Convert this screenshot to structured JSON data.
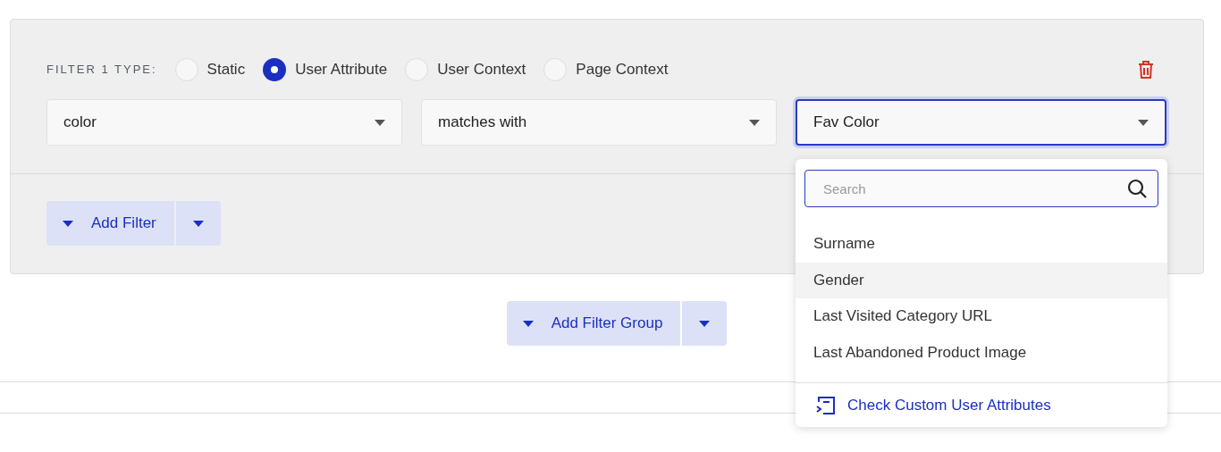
{
  "filter_type": {
    "label": "FILTER 1 TYPE:",
    "options": [
      {
        "label": "Static",
        "selected": false
      },
      {
        "label": "User Attribute",
        "selected": true
      },
      {
        "label": "User Context",
        "selected": false
      },
      {
        "label": "Page Context",
        "selected": false
      }
    ]
  },
  "selects": [
    {
      "value": "color",
      "focused": false
    },
    {
      "value": "matches with",
      "focused": false
    },
    {
      "value": "Fav Color",
      "focused": true
    }
  ],
  "dropdown": {
    "search": {
      "placeholder": "Search"
    },
    "items": [
      {
        "label": "Surname",
        "highlighted": false
      },
      {
        "label": "Gender",
        "highlighted": true
      },
      {
        "label": "Last Visited Category URL",
        "highlighted": false
      },
      {
        "label": "Last Abandoned Product Image",
        "highlighted": false
      }
    ],
    "footer_link": "Check Custom User Attributes"
  },
  "add_filter": "Add Filter",
  "add_filter_group": "Add Filter Group"
}
